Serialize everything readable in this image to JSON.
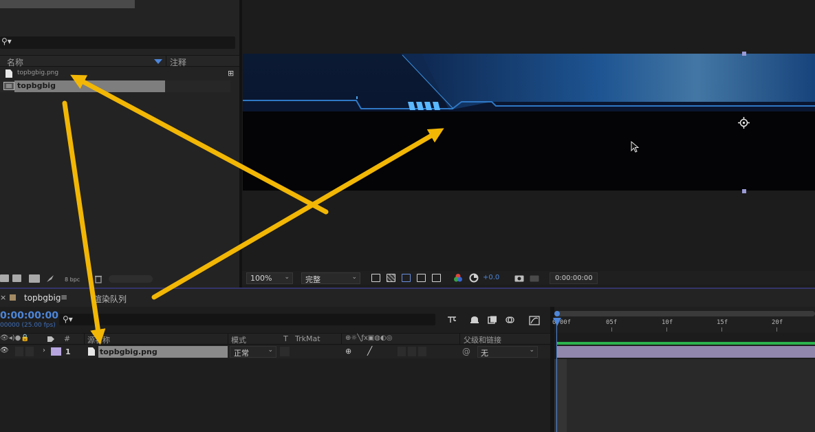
{
  "project": {
    "search_placeholder": "",
    "col_name": "名称",
    "col_comment": "注释",
    "items": [
      {
        "label": "topbgbig.png",
        "type": "footage"
      },
      {
        "label": "topbgbig",
        "type": "composition"
      }
    ],
    "bpc": "8 bpc"
  },
  "viewer": {
    "zoom": "100%",
    "quality": "完整",
    "exposure": "+0.0",
    "timecode": "0:00:00:00"
  },
  "timeline": {
    "tab_label": "topbgbig",
    "render_queue_label": "渲染队列",
    "current_time": "0:00:00:00",
    "fps_label": "00000 (25.00 fps)",
    "headers": {
      "num": "#",
      "source_name": "源名称",
      "mode": "模式",
      "t": "T",
      "trkmat": "TrkMat",
      "parent": "父级和链接"
    },
    "layer": {
      "index": "1",
      "name": "topbgbig.png",
      "mode": "正常",
      "parent": "无"
    },
    "ruler_ticks": [
      "0:00f",
      "05f",
      "10f",
      "15f",
      "20f"
    ]
  },
  "colors": {
    "accent_blue": "#4d86d9",
    "arrow_yellow": "#f2b705",
    "layer_label": "#b7a5e0",
    "layer_bar": "#9187ad",
    "work_bar": "#2bb24c"
  }
}
